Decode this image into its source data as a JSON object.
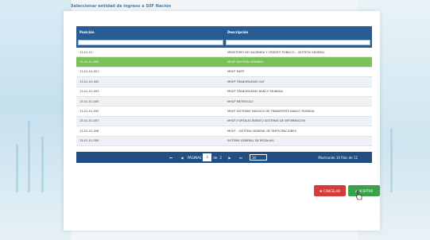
{
  "modal": {
    "title": "Seleccionar entidad de ingreso a SIIF Nación"
  },
  "table": {
    "headers": {
      "position": "Posición",
      "description": "Descripción"
    },
    "filter_placeholders": {
      "position": "",
      "description": ""
    },
    "rows": [
      {
        "position": "13-01-01",
        "description": "MINISTERIO DE HACIENDA Y CRÉDITO PÚBLICO – GESTIÓN GENERAL",
        "selected": false
      },
      {
        "position": "13-01-01-000",
        "description": "MHCP GESTION GENERAL",
        "selected": true
      },
      {
        "position": "13-01-01-001",
        "description": "MHCP MATP",
        "selected": false
      },
      {
        "position": "13-01-01-002",
        "description": "MHCP TRANSMILENIO CAF",
        "selected": false
      },
      {
        "position": "13-01-01-003",
        "description": "MHCP TRANSMILENIO BANCO MUNDIAL",
        "selected": false
      },
      {
        "position": "13-01-01-004",
        "description": "MHCP METROCALI",
        "selected": false
      },
      {
        "position": "13-01-01-005",
        "description": "MHCP SISTEMAS MASIVOS DE TRANSPORTE BANCO MUNDIAL",
        "selected": false
      },
      {
        "position": "13-01-01-007",
        "description": "MHCP–FORTALECIMIENTO SISTEMAS DE INFORMACION",
        "selected": false
      },
      {
        "position": "13-01-01-008",
        "description": "MHCP – SISTEMA GENERAL DE PARTICIPACIONES",
        "selected": false
      },
      {
        "position": "13-01-01-009",
        "description": "SISTEMA GENERAL DE REGALIAS",
        "selected": false
      }
    ]
  },
  "pager": {
    "first": "⏮",
    "prev": "◀",
    "pages_label": "PÁGINAS",
    "current_page": "1",
    "of_label": "de",
    "total_pages": "2",
    "next": "▶",
    "last": "⏭",
    "page_size": "10",
    "info": "Mostrando 10 filas de 12"
  },
  "buttons": {
    "cancel": "✖ CANCELAR",
    "accept": "✔ ACEPTAR"
  },
  "colors": {
    "header": "#275c94",
    "selected_row": "#7bc15a",
    "cancel": "#d63a3a",
    "accept": "#3aa24a"
  }
}
